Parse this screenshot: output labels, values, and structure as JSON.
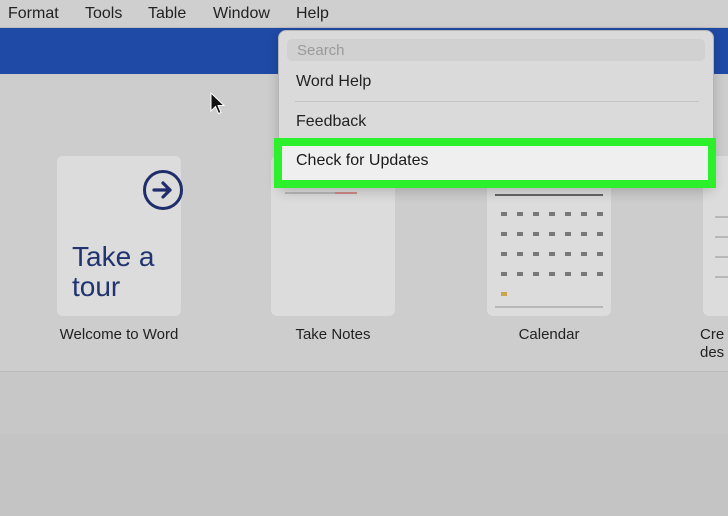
{
  "menubar": {
    "items": [
      "Format",
      "Tools",
      "Table",
      "Window",
      "Help"
    ]
  },
  "help_menu": {
    "search_placeholder": "Search",
    "items": [
      "Word Help",
      "Feedback",
      "Check for Updates"
    ]
  },
  "templates": [
    {
      "label": "Welcome to Word",
      "preview_text": "Take a tour"
    },
    {
      "label": "Take Notes"
    },
    {
      "label": "Calendar"
    },
    {
      "label": "Cre des"
    }
  ],
  "colors": {
    "title_bar": "#1f4aa6",
    "highlight": "#2df02d"
  },
  "icons": {
    "tour": "arrow-right-circle-icon",
    "pointer": "mouse-pointer-icon"
  }
}
